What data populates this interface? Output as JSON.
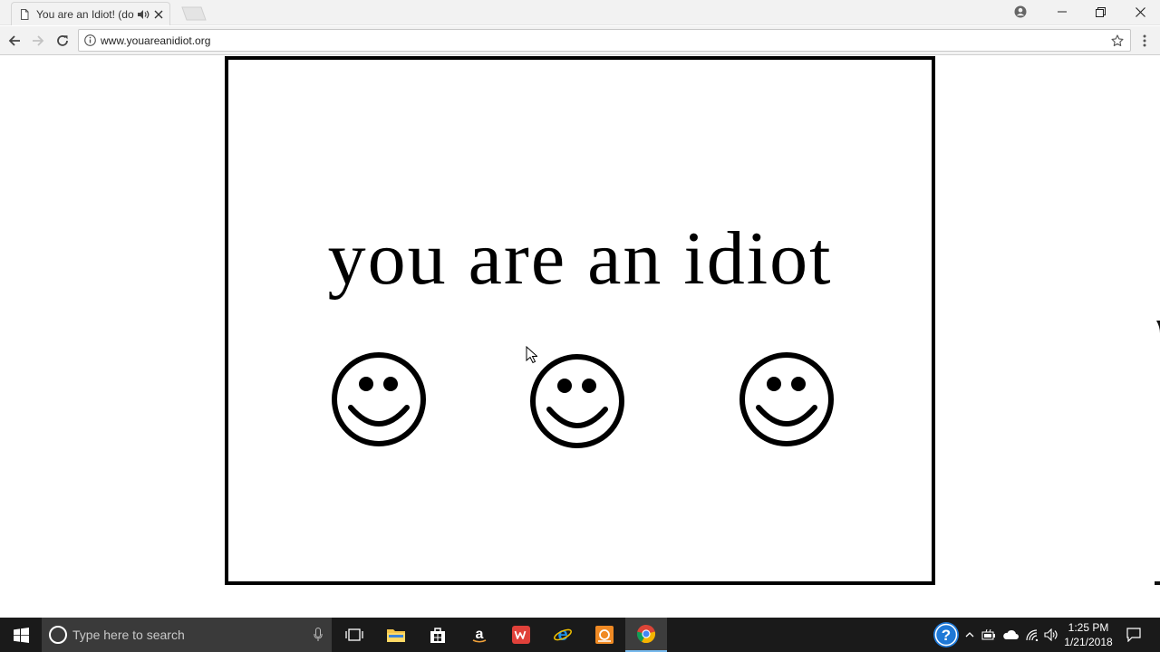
{
  "browser": {
    "tab_title": "You are an Idiot! (dot",
    "url": "www.youareanidiot.org"
  },
  "page": {
    "headline": "you are an idiot",
    "smiley_count": 3
  },
  "taskbar": {
    "search_placeholder": "Type here to search",
    "time": "1:25 PM",
    "date": "1/21/2018",
    "pinned_apps": [
      "task-view",
      "file-explorer",
      "store",
      "amazon",
      "wps-office",
      "internet-explorer",
      "media-app",
      "chrome"
    ],
    "active_app": "chrome"
  },
  "colors": {
    "chrome_bg": "#f2f2f2",
    "taskbar_bg": "#1a1a1a",
    "taskbar_search_bg": "#3a3a3a",
    "accent": "#76b9ed"
  }
}
